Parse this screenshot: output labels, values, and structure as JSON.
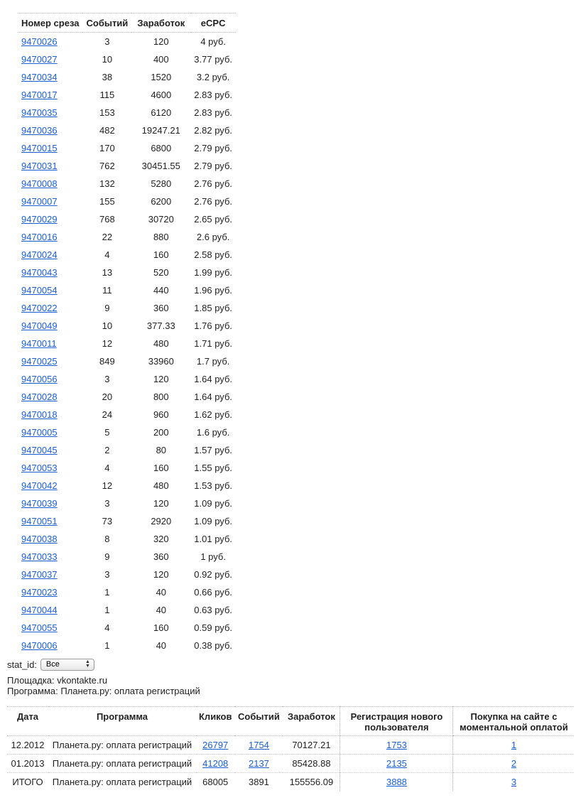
{
  "slices_table": {
    "headers": [
      "Номер среза",
      "Событий",
      "Заработок",
      "eCPC"
    ],
    "rows": [
      [
        "9470026",
        "3",
        "120",
        "4 руб."
      ],
      [
        "9470027",
        "10",
        "400",
        "3.77 руб."
      ],
      [
        "9470034",
        "38",
        "1520",
        "3.2 руб."
      ],
      [
        "9470017",
        "115",
        "4600",
        "2.83 руб."
      ],
      [
        "9470035",
        "153",
        "6120",
        "2.83 руб."
      ],
      [
        "9470036",
        "482",
        "19247.21",
        "2.82 руб."
      ],
      [
        "9470015",
        "170",
        "6800",
        "2.79 руб."
      ],
      [
        "9470031",
        "762",
        "30451.55",
        "2.79 руб."
      ],
      [
        "9470008",
        "132",
        "5280",
        "2.76 руб."
      ],
      [
        "9470007",
        "155",
        "6200",
        "2.76 руб."
      ],
      [
        "9470029",
        "768",
        "30720",
        "2.65 руб."
      ],
      [
        "9470016",
        "22",
        "880",
        "2.6 руб."
      ],
      [
        "9470024",
        "4",
        "160",
        "2.58 руб."
      ],
      [
        "9470043",
        "13",
        "520",
        "1.99 руб."
      ],
      [
        "9470054",
        "11",
        "440",
        "1.96 руб."
      ],
      [
        "9470022",
        "9",
        "360",
        "1.85 руб."
      ],
      [
        "9470049",
        "10",
        "377.33",
        "1.76 руб."
      ],
      [
        "9470011",
        "12",
        "480",
        "1.71 руб."
      ],
      [
        "9470025",
        "849",
        "33960",
        "1.7 руб."
      ],
      [
        "9470056",
        "3",
        "120",
        "1.64 руб."
      ],
      [
        "9470028",
        "20",
        "800",
        "1.64 руб."
      ],
      [
        "9470018",
        "24",
        "960",
        "1.62 руб."
      ],
      [
        "9470005",
        "5",
        "200",
        "1.6 руб."
      ],
      [
        "9470045",
        "2",
        "80",
        "1.57 руб."
      ],
      [
        "9470053",
        "4",
        "160",
        "1.55 руб."
      ],
      [
        "9470042",
        "12",
        "480",
        "1.53 руб."
      ],
      [
        "9470039",
        "3",
        "120",
        "1.09 руб."
      ],
      [
        "9470051",
        "73",
        "2920",
        "1.09 руб."
      ],
      [
        "9470038",
        "8",
        "320",
        "1.01 руб."
      ],
      [
        "9470033",
        "9",
        "360",
        "1 руб."
      ],
      [
        "9470037",
        "3",
        "120",
        "0.92 руб."
      ],
      [
        "9470023",
        "1",
        "40",
        "0.66 руб."
      ],
      [
        "9470044",
        "1",
        "40",
        "0.63 руб."
      ],
      [
        "9470055",
        "4",
        "160",
        "0.59 руб."
      ],
      [
        "9470006",
        "1",
        "40",
        "0.38 руб."
      ]
    ]
  },
  "filter": {
    "label": "stat_id:",
    "selected": "Все"
  },
  "info": {
    "site": "Площадка: vkontakte.ru",
    "program": "Программа: Планета.ру: оплата регистраций"
  },
  "stats_table": {
    "headers": [
      "Дата",
      "Программа",
      "Кликов",
      "Событий",
      "Заработок",
      "Регистрация нового пользователя",
      "Покупка на сайте с моментальной оплатой"
    ],
    "rows": [
      {
        "date": "12.2012",
        "program": "Планета.ру: оплата регистраций",
        "clicks": "26797",
        "events": "1754",
        "earnings": "70127.21",
        "registrations": "1753",
        "purchases": "1",
        "linked": true
      },
      {
        "date": "01.2013",
        "program": "Планета.ру: оплата регистраций",
        "clicks": "41208",
        "events": "2137",
        "earnings": "85428.88",
        "registrations": "2135",
        "purchases": "2",
        "linked": true
      },
      {
        "date": "ИТОГО",
        "program": "Планета.ру: оплата регистраций",
        "clicks": "68005",
        "events": "3891",
        "earnings": "155556.09",
        "registrations": "3888",
        "purchases": "3",
        "linked": false
      }
    ]
  }
}
